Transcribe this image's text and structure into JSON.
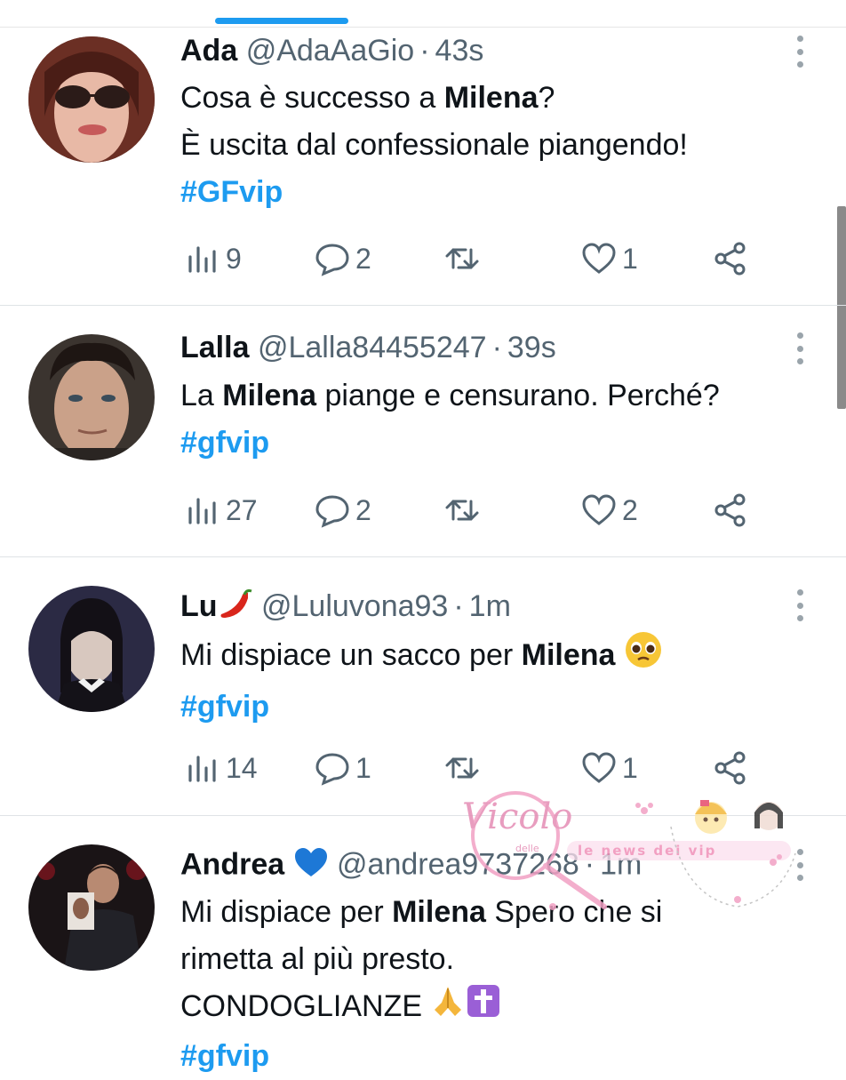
{
  "colors": {
    "accent": "#1d9bf0",
    "text": "#0f1419",
    "muted": "#536471",
    "divider": "#dfe3e6"
  },
  "tweets": [
    {
      "name": "Ada",
      "handle": "@AdaAaGio",
      "time": "43s",
      "lines": [
        [
          "Cosa è successo a ",
          "Milena",
          "?"
        ],
        [
          "È uscita dal confessionale piangendo!",
          "",
          ""
        ]
      ],
      "hashtag": "#GFvip",
      "views": "9",
      "replies": "2",
      "retweets": "",
      "likes": "1"
    },
    {
      "name": "Lalla",
      "handle": "@Lalla84455247",
      "time": "39s",
      "lines": [
        [
          "La ",
          "Milena",
          " piange e censurano. Perché?"
        ]
      ],
      "hashtag": "#gfvip",
      "views": "27",
      "replies": "2",
      "retweets": "",
      "likes": "2"
    },
    {
      "name": "Lu",
      "name_icon": "chili-pepper-emoji",
      "handle": "@Luluvona93",
      "time": "1m",
      "lines": [
        [
          "Mi dispiace un sacco per ",
          "Milena",
          " "
        ]
      ],
      "line_icon": "pleading-face-emoji",
      "hashtag": "#gfvip",
      "views": "14",
      "replies": "1",
      "retweets": "",
      "likes": "1"
    },
    {
      "name": "Andrea",
      "name_icon": "blue-heart-emoji",
      "handle": "@andrea9737268",
      "time": "1m",
      "lines": [
        [
          "Mi dispiace per ",
          "Milena",
          " Spero che si"
        ],
        [
          "rimetta al più presto.",
          "",
          ""
        ],
        [
          " CONDOGLIANZE ",
          "",
          ""
        ]
      ],
      "line_icons": [
        "folded-hands-emoji",
        "latin-cross-emoji"
      ],
      "hashtag": "#gfvip"
    }
  ],
  "watermark": {
    "script": "Vicolo",
    "small": "delle",
    "banner": "le news dei vip"
  }
}
